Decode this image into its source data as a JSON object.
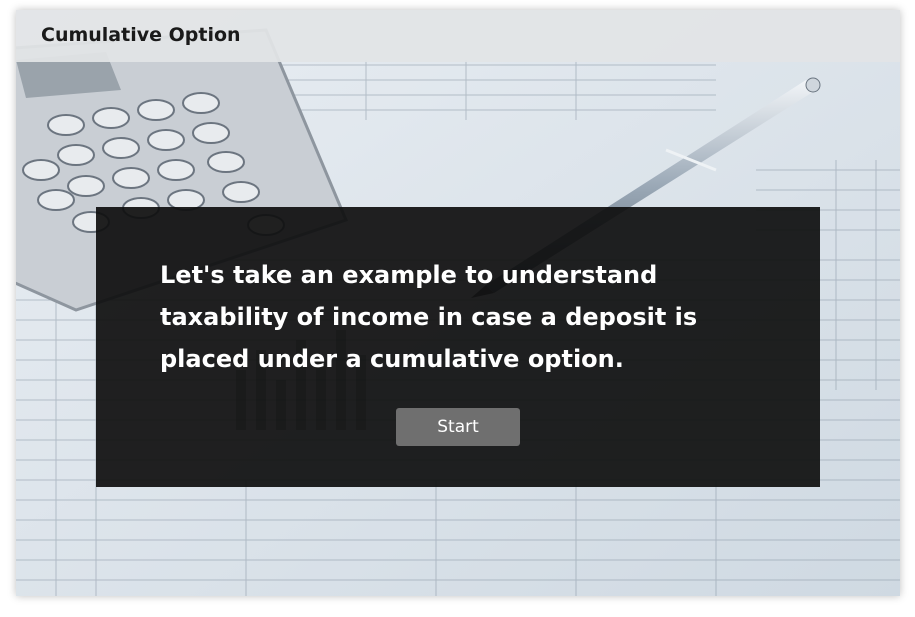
{
  "header": {
    "title": "Cumulative Option"
  },
  "intro": {
    "message": "Let's take an example to understand taxability of income in case a deposit is placed under a cumulative option.",
    "start_label": "Start"
  },
  "colors": {
    "dialog_bg": "#0e0e0e",
    "button_bg": "#6f6f6f",
    "title_bar_bg": "#e2e4e6"
  }
}
